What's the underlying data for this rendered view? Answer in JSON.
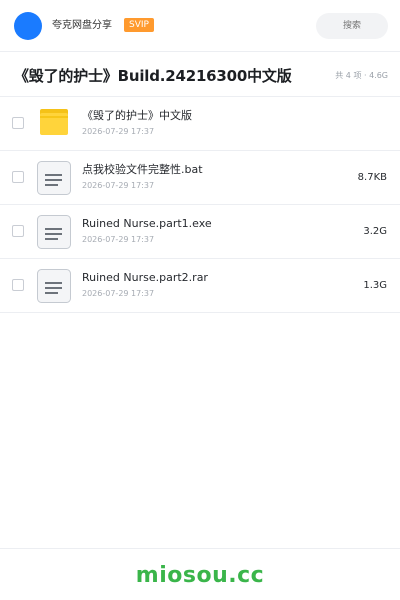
{
  "header": {
    "brand": "夸克网盘分享",
    "badge": "SVIP",
    "search_placeholder": "搜索",
    "accent_color": "#1a7bff",
    "badge_color": "#ff9a2e"
  },
  "share": {
    "title": "《毁了的护士》Build.24216300中文版",
    "summary": "共 4 项 · 4.6G"
  },
  "files": [
    {
      "name": "《毁了的护士》中文版",
      "date": "2026-07-29 17:37",
      "size": "",
      "icon": "folder-icon"
    },
    {
      "name": "点我校验文件完整性.bat",
      "date": "2026-07-29 17:37",
      "size": "8.7KB",
      "icon": "file-icon"
    },
    {
      "name": "Ruined Nurse.part1.exe",
      "date": "2026-07-29 17:37",
      "size": "3.2G",
      "icon": "file-icon"
    },
    {
      "name": "Ruined Nurse.part2.rar",
      "date": "2026-07-29 17:37",
      "size": "1.3G",
      "icon": "file-icon"
    }
  ],
  "footer": {
    "watermark": "miosou.cc",
    "watermark_color": "#3ab54a"
  }
}
